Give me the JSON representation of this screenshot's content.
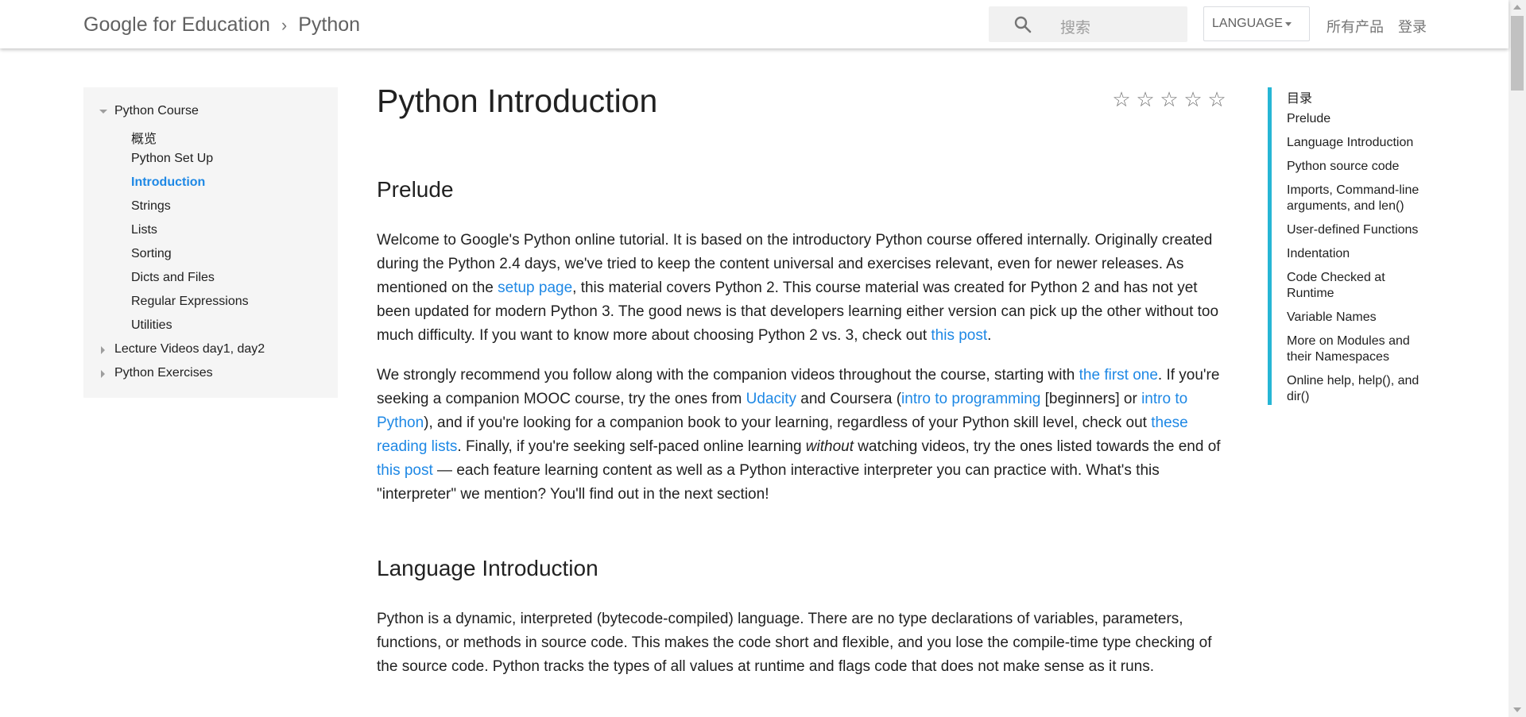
{
  "header": {
    "brand": "Google for Education",
    "separator": "›",
    "section": "Python",
    "search_placeholder": "搜索",
    "language_label": "LANGUAGE",
    "all_products": "所有产品",
    "sign_in": "登录"
  },
  "sidebar": {
    "course": "Python Course",
    "items": [
      "概览",
      "Python Set Up",
      "Introduction",
      "Strings",
      "Lists",
      "Sorting",
      "Dicts and Files",
      "Regular Expressions",
      "Utilities"
    ],
    "lecture_videos": "Lecture Videos day1, day2",
    "exercises": "Python Exercises"
  },
  "main": {
    "title": "Python Introduction",
    "rating_stars": [
      "☆",
      "☆",
      "☆",
      "☆",
      "☆"
    ],
    "prelude": {
      "heading": "Prelude",
      "p1_a": "Welcome to Google's Python online tutorial. It is based on the introductory Python course offered internally. Originally created during the Python 2.4 days, we've tried to keep the content universal and exercises relevant, even for newer releases. As mentioned on the ",
      "p1_link1": "setup page",
      "p1_b": ", this material covers Python 2. This course material was created for Python 2 and has not yet been updated for modern Python 3. The good news is that developers learning either version can pick up the other without too much difficulty. If you want to know more about choosing Python 2 vs. 3, check out ",
      "p1_link2": "this post",
      "p1_c": ".",
      "p2_a": "We strongly recommend you follow along with the companion videos throughout the course, starting with ",
      "p2_link1": "the first one",
      "p2_b": ". If you're seeking a companion MOOC course, try the ones from ",
      "p2_link2": "Udacity",
      "p2_c": " and Coursera (",
      "p2_link3": "intro to programming",
      "p2_d": " [beginners] or ",
      "p2_link4": "intro to Python",
      "p2_e": "), and if you're looking for a companion book to your learning, regardless of your Python skill level, check out ",
      "p2_link5": "these reading lists",
      "p2_f": ". Finally, if you're seeking self-paced online learning ",
      "p2_em": "without",
      "p2_g": " watching videos, try the ones listed towards the end of ",
      "p2_link6": "this post",
      "p2_h": " — each feature learning content as well as a Python interactive interpreter you can practice with. What's this \"interpreter\" we mention? You'll find out in the next section!"
    },
    "lang_intro": {
      "heading": "Language Introduction",
      "p1": "Python is a dynamic, interpreted (bytecode-compiled) language. There are no type declarations of variables, parameters, functions, or methods in source code. This makes the code short and flexible, and you lose the compile-time type checking of the source code. Python tracks the types of all values at runtime and flags code that does not make sense as it runs."
    }
  },
  "toc": {
    "title": "目录",
    "items": [
      "Prelude",
      "Language Introduction",
      "Python source code",
      "Imports, Command-line arguments, and len()",
      "User-defined Functions",
      "Indentation",
      "Code Checked at Runtime",
      "Variable Names",
      "More on Modules and their Namespaces",
      "Online help, help(), and dir()"
    ]
  },
  "colors": {
    "link": "#1e88e5",
    "toc_accent": "#26b6d5",
    "sidebar_bg": "#f5f5f5"
  }
}
